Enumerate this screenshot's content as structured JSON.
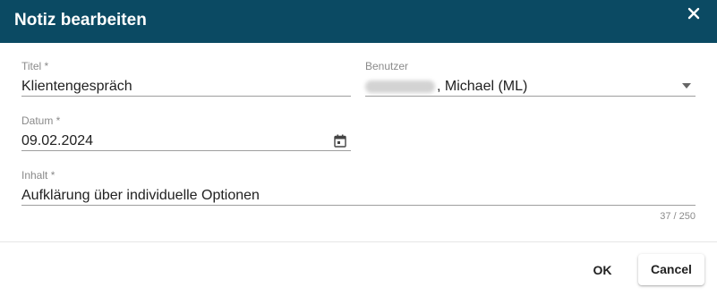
{
  "dialog": {
    "title": "Notiz bearbeiten",
    "close_icon": "close-icon",
    "header_color": "#0b4a63"
  },
  "form": {
    "title_field": {
      "label": "Titel *",
      "value": "Klientengespräch"
    },
    "user_field": {
      "label": "Benutzer",
      "value_visible": ", Michael (ML)",
      "dropdown_icon": "caret-down-icon"
    },
    "date_field": {
      "label": "Datum *",
      "value": "09.02.2024",
      "icon": "calendar-icon"
    },
    "content_field": {
      "label": "Inhalt *",
      "value": "Aufklärung über individuelle Optionen",
      "counter": "37 / 250"
    }
  },
  "actions": {
    "ok_label": "OK",
    "cancel_label": "Cancel"
  }
}
